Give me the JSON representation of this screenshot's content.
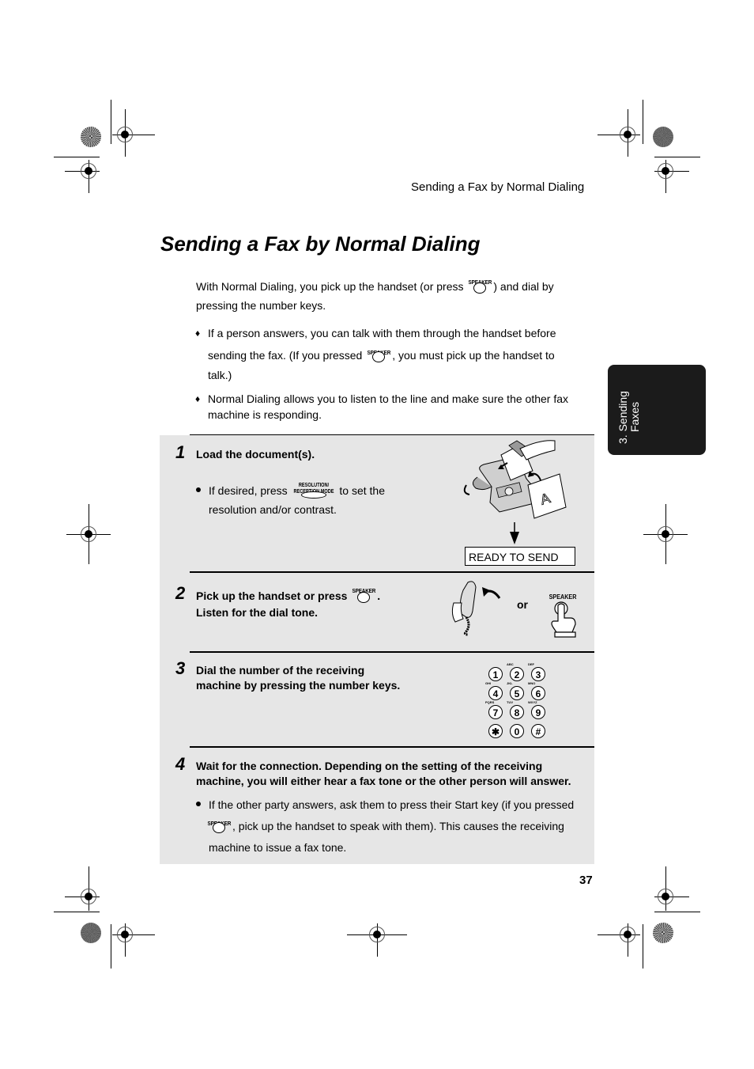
{
  "running_head": "Sending a Fax by Normal Dialing",
  "title": "Sending a Fax by Normal Dialing",
  "intro": {
    "before": "With Normal Dialing, you pick up the handset (or press",
    "after": ") and dial by",
    "line2": "pressing the number keys.",
    "key_label": "SPEAKER"
  },
  "bullets": [
    {
      "line1": "If a person answers, you can talk with them through the handset before",
      "line2_before": "sending the fax. (If you pressed",
      "line2_after": ", you must pick up the handset to",
      "line3": "talk.)",
      "key_label": "SPEAKER"
    },
    {
      "line1": "Normal Dialing allows you to listen to the line and make sure the other fax",
      "line2": "machine is responding."
    }
  ],
  "side_tab": {
    "line1": "3. Sending",
    "line2": "Faxes"
  },
  "steps": [
    {
      "number": "1",
      "text": "Load the document(s).",
      "sub_before": "If desired, press",
      "sub_key_top": "RESOLUTION/",
      "sub_key_bottom": "RECEPTION MODE",
      "sub_after": "to set the",
      "sub_line2": "resolution and/or contrast.",
      "display": "READY TO SEND"
    },
    {
      "number": "2",
      "line1": "Pick up the handset or press",
      "line1_after": ".",
      "line2": "Listen for the dial tone.",
      "key_label": "SPEAKER",
      "or_label": "or",
      "illus_key_label": "SPEAKER"
    },
    {
      "number": "3",
      "line1": "Dial the number of the receiving",
      "line2": "machine by pressing the number keys.",
      "keypad": [
        {
          "key": "1",
          "letters": ""
        },
        {
          "key": "2",
          "letters": "ABC"
        },
        {
          "key": "3",
          "letters": "DEF"
        },
        {
          "key": "4",
          "letters": "GHI"
        },
        {
          "key": "5",
          "letters": "JKL"
        },
        {
          "key": "6",
          "letters": "MNO"
        },
        {
          "key": "7",
          "letters": "PQRS"
        },
        {
          "key": "8",
          "letters": "TUV"
        },
        {
          "key": "9",
          "letters": "WXYZ"
        },
        {
          "key": "✱",
          "letters": ""
        },
        {
          "key": "0",
          "letters": ""
        },
        {
          "key": "#",
          "letters": ""
        }
      ]
    },
    {
      "number": "4",
      "line1": "Wait for the connection. Depending on the setting of the receiving",
      "line2": "machine, you will either hear a fax tone or the other person will answer.",
      "sub_line1": "If the other party answers, ask them to press their Start key (if you pressed",
      "sub_line2_after": ", pick up the handset to speak with them). This causes the receiving",
      "sub_line3": "machine to issue a fax tone.",
      "key_label": "SPEAKER"
    }
  ],
  "page_number": "37"
}
